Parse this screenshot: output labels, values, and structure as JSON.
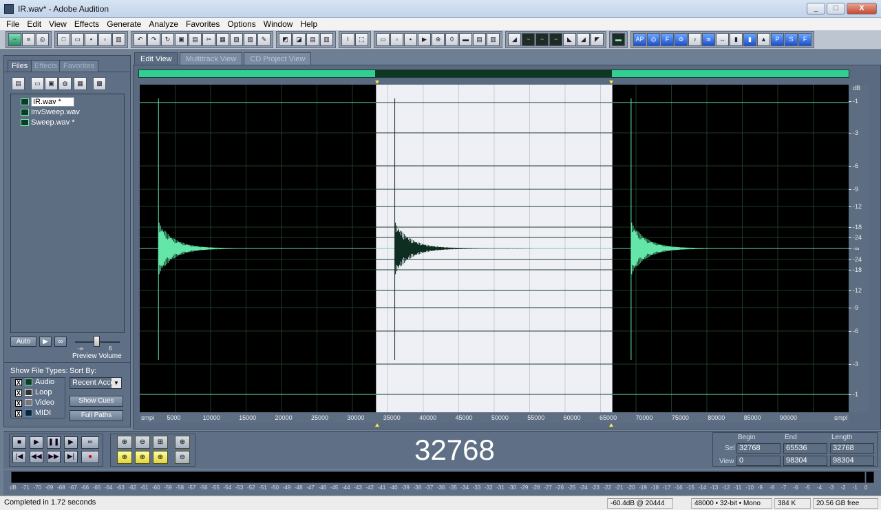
{
  "window": {
    "title": "IR.wav* - Adobe Audition",
    "controls": [
      "_",
      "□",
      "X"
    ]
  },
  "menu": [
    "File",
    "Edit",
    "View",
    "Effects",
    "Generate",
    "Analyze",
    "Favorites",
    "Options",
    "Window",
    "Help"
  ],
  "left_panel": {
    "tabs": [
      "Files",
      "Effects",
      "Favorites"
    ],
    "files": [
      "IR.wav *",
      "InvSweep.wav",
      "Sweep.wav *"
    ],
    "auto_button": "Auto",
    "volume_labels": {
      "min": "-∞",
      "max": "6"
    },
    "preview_volume": "Preview Volume",
    "show_file_types_label": "Show File Types:",
    "sort_by_label": "Sort By:",
    "sort_by_value": "Recent Acce",
    "file_types": [
      {
        "label": "Audio",
        "checked": "X"
      },
      {
        "label": "Loop",
        "checked": "X"
      },
      {
        "label": "Video",
        "checked": "X"
      },
      {
        "label": "MIDI",
        "checked": "X"
      }
    ],
    "show_cues": "Show Cues",
    "full_paths": "Full Paths"
  },
  "view_tabs": [
    "Edit View",
    "Multitrack View",
    "CD Project View"
  ],
  "waveform": {
    "unit": "smpl",
    "db_unit": "dB",
    "db_labels": [
      "-1",
      "-3",
      "-6",
      "-9",
      "-12",
      "-18",
      "-24",
      "-∞",
      "-24",
      "-18",
      "-12",
      "-9",
      "-6",
      "-3",
      "-1"
    ],
    "ruler_labels": [
      "5000",
      "10000",
      "15000",
      "20000",
      "25000",
      "30000",
      "35000",
      "40000",
      "45000",
      "50000",
      "55000",
      "60000",
      "65000",
      "70000",
      "75000",
      "80000",
      "85000",
      "90000"
    ],
    "selection_start": 32768,
    "selection_end": 65536,
    "view_end": 98304,
    "colors": {
      "wave": "#63e6a8",
      "selection_bg": "#eef0f5",
      "selected_wave": "#0f2e22",
      "background": "#000000"
    }
  },
  "timecode": "32768",
  "selection_view": {
    "headers": [
      "Begin",
      "End",
      "Length"
    ],
    "sel_label": "Sel",
    "view_label": "View",
    "sel": [
      "32768",
      "65536",
      "32768"
    ],
    "view": [
      "0",
      "98304",
      "98304"
    ]
  },
  "meter_labels": [
    "dB",
    "-71",
    "-70",
    "-69",
    "-68",
    "-67",
    "-66",
    "-65",
    "-64",
    "-63",
    "-62",
    "-61",
    "-60",
    "-59",
    "-58",
    "-57",
    "-56",
    "-55",
    "-54",
    "-53",
    "-52",
    "-51",
    "-50",
    "-49",
    "-48",
    "-47",
    "-46",
    "-45",
    "-44",
    "-43",
    "-42",
    "-41",
    "-40",
    "-39",
    "-38",
    "-37",
    "-36",
    "-35",
    "-34",
    "-33",
    "-32",
    "-31",
    "-30",
    "-29",
    "-28",
    "-27",
    "-26",
    "-25",
    "-24",
    "-23",
    "-22",
    "-21",
    "-20",
    "-19",
    "-18",
    "-17",
    "-16",
    "-15",
    "-14",
    "-13",
    "-12",
    "-11",
    "-10",
    "-9",
    "-8",
    "-7",
    "-6",
    "-5",
    "-4",
    "-3",
    "-2",
    "-1",
    "0"
  ],
  "status": {
    "message": "Completed in 1.72 seconds",
    "level": "-60.4dB @ 20444",
    "format": "48000 • 32-bit • Mono",
    "size": "384 K",
    "free": "20.56 GB free"
  }
}
